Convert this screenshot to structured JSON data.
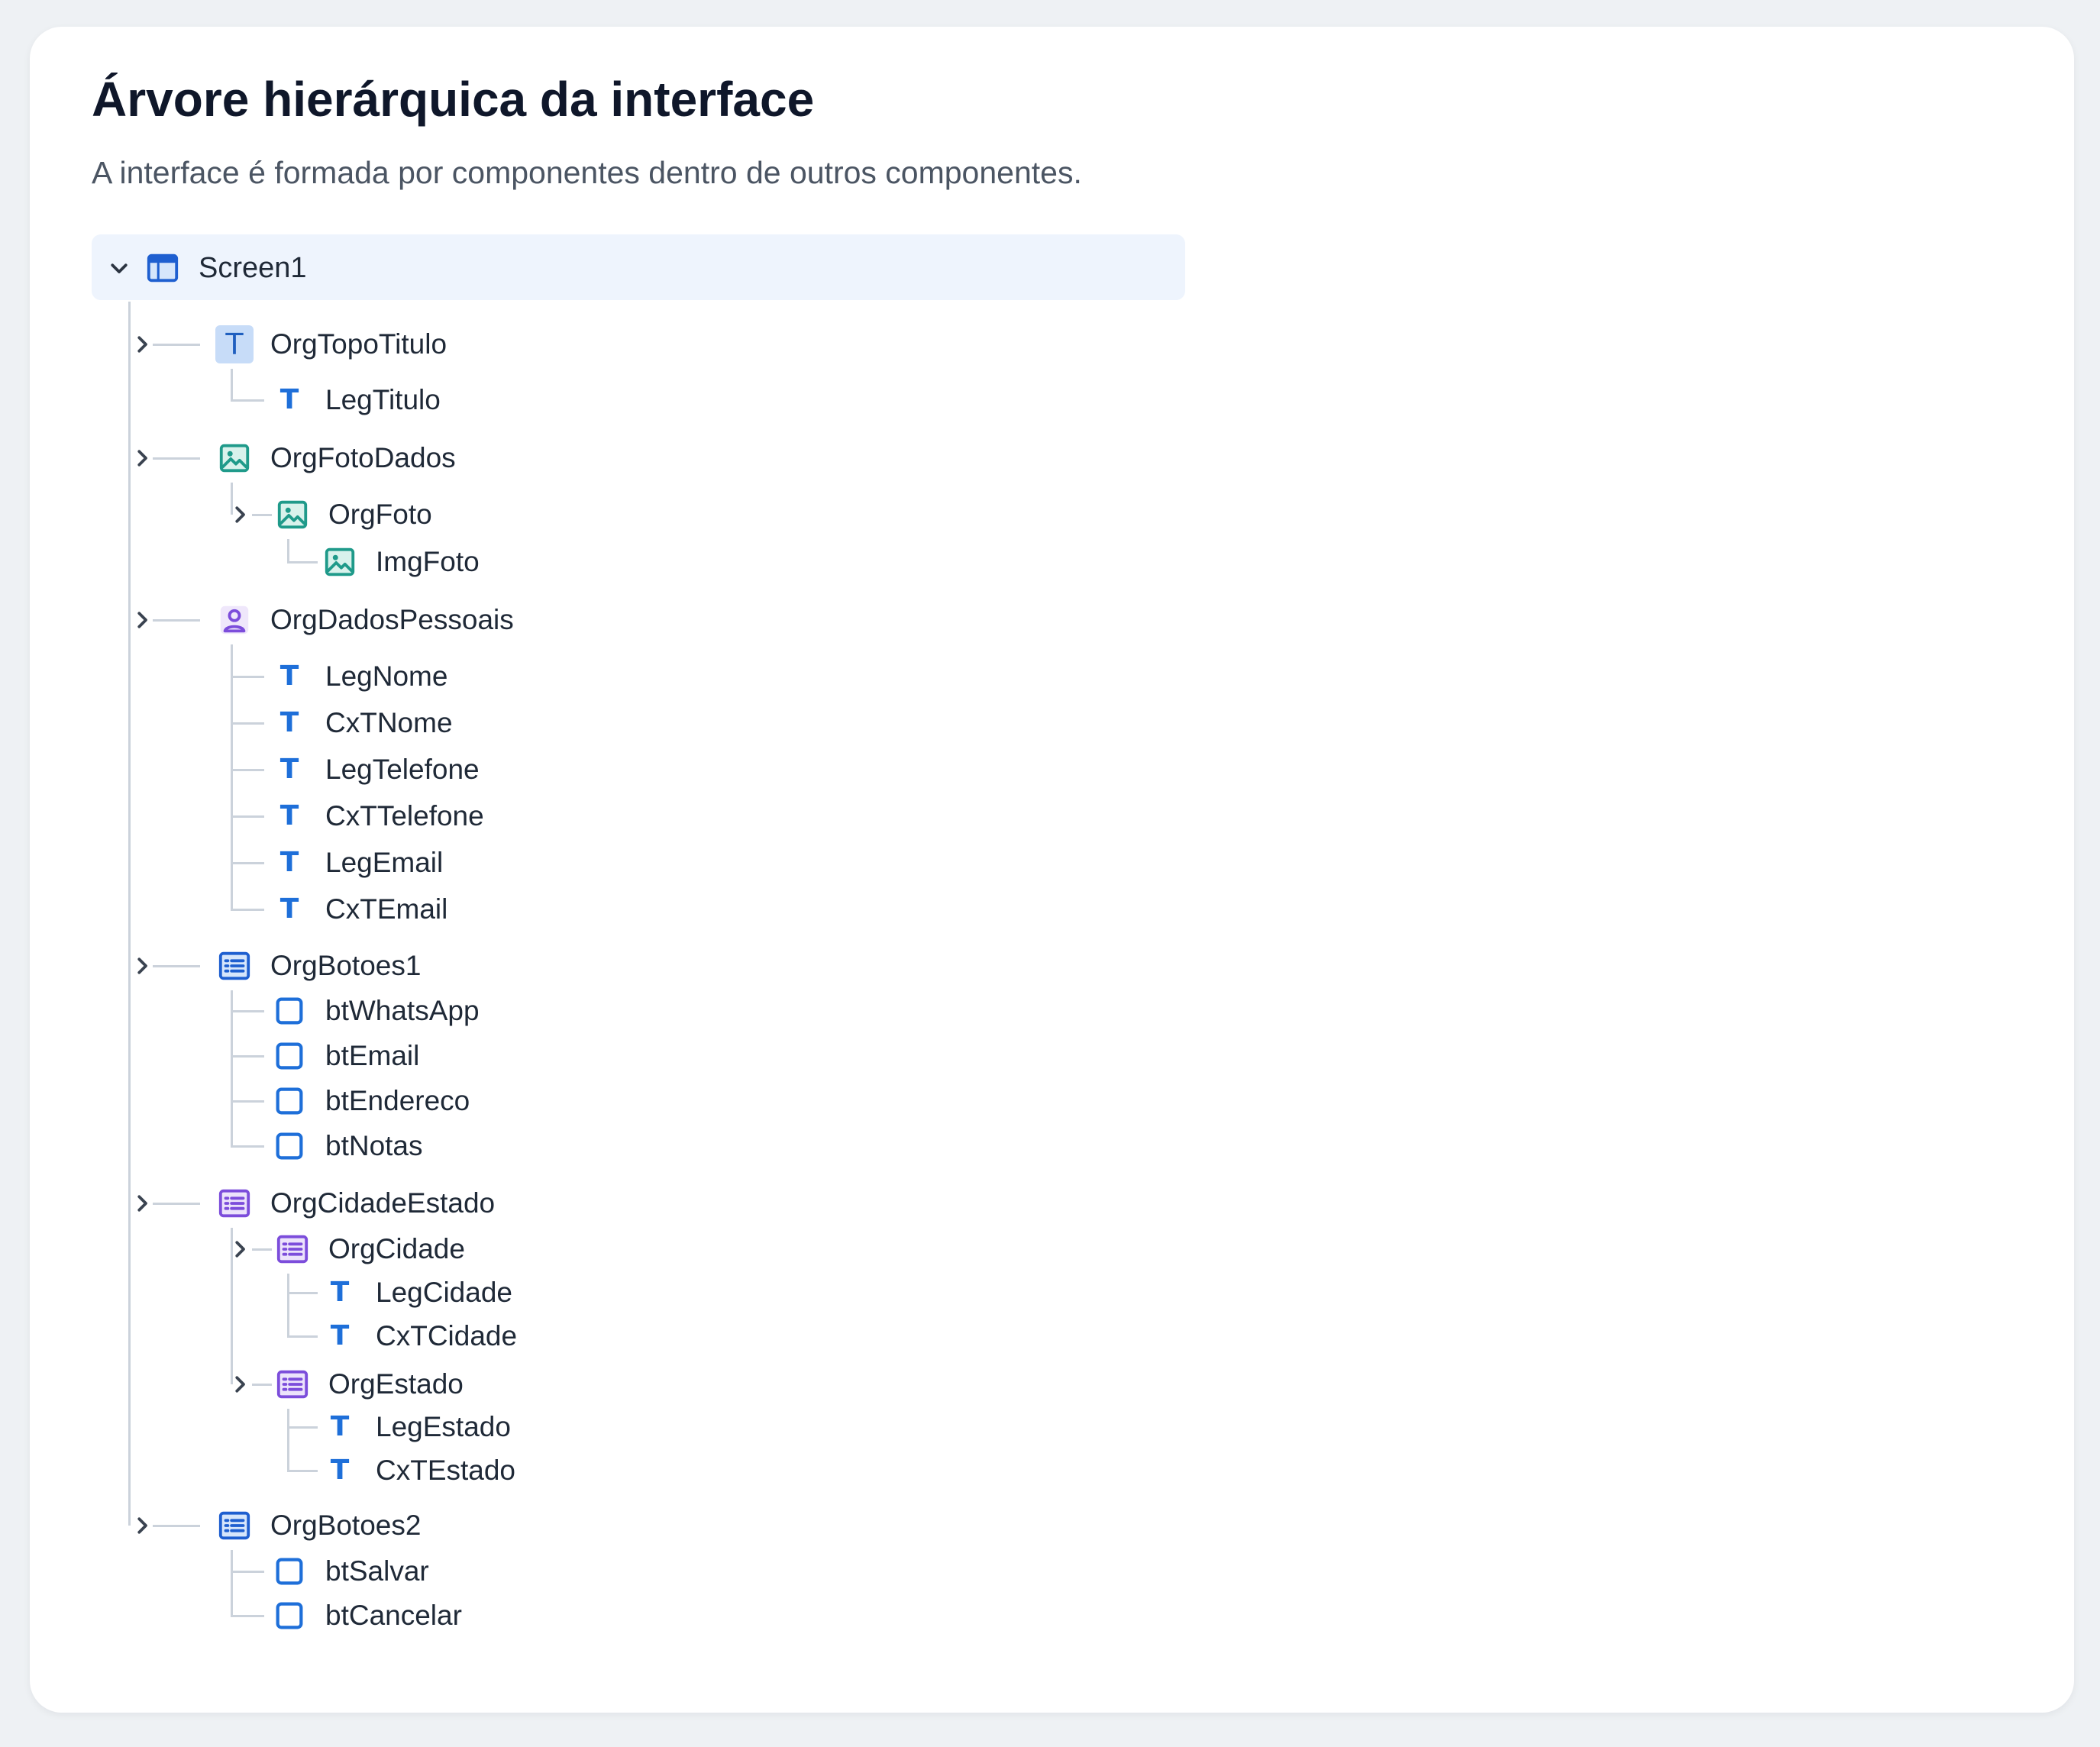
{
  "header": {
    "title": "Árvore hierárquica da interface",
    "subtitle": "A interface é formada por componentes dentro de outros componentes."
  },
  "colors": {
    "text_icon": "#1e6fd9",
    "image_icon": "#1f9a8a",
    "person_icon": "#7c4ddb",
    "list_blue_icon": "#1e5fd0",
    "list_purple_icon": "#7c4ddb",
    "button_icon": "#1e6fd9",
    "tree_line": "#cbd2db",
    "root_highlight": "#eef4fd"
  },
  "tree": {
    "label": "Screen1",
    "icon": "window-icon",
    "expanded": true,
    "children": [
      {
        "label": "OrgTopoTitulo",
        "icon": "text-box-icon",
        "children": [
          {
            "label": "LegTitulo",
            "icon": "text-icon"
          }
        ]
      },
      {
        "label": "OrgFotoDados",
        "icon": "image-icon",
        "children": [
          {
            "label": "OrgFoto",
            "icon": "image-icon",
            "children": [
              {
                "label": "ImgFoto",
                "icon": "image-icon"
              }
            ]
          }
        ]
      },
      {
        "label": "OrgDadosPessoais",
        "icon": "person-icon",
        "children": [
          {
            "label": "LegNome",
            "icon": "text-icon"
          },
          {
            "label": "CxTNome",
            "icon": "text-icon"
          },
          {
            "label": "LegTelefone",
            "icon": "text-icon"
          },
          {
            "label": "CxTTelefone",
            "icon": "text-icon"
          },
          {
            "label": "LegEmail",
            "icon": "text-icon"
          },
          {
            "label": "CxTEmail",
            "icon": "text-icon"
          }
        ]
      },
      {
        "label": "OrgBotoes1",
        "icon": "list-icon",
        "children": [
          {
            "label": "btWhatsApp",
            "icon": "button-icon"
          },
          {
            "label": "btEmail",
            "icon": "button-icon"
          },
          {
            "label": "btEndereco",
            "icon": "button-icon"
          },
          {
            "label": "btNotas",
            "icon": "button-icon"
          }
        ]
      },
      {
        "label": "OrgCidadeEstado",
        "icon": "list-purple-icon",
        "children": [
          {
            "label": "OrgCidade",
            "icon": "list-purple-icon",
            "children": [
              {
                "label": "LegCidade",
                "icon": "text-icon"
              },
              {
                "label": "CxTCidade",
                "icon": "text-icon"
              }
            ]
          },
          {
            "label": "OrgEstado",
            "icon": "list-purple-icon",
            "children": [
              {
                "label": "LegEstado",
                "icon": "text-icon"
              },
              {
                "label": "CxTEstado",
                "icon": "text-icon"
              }
            ]
          }
        ]
      },
      {
        "label": "OrgBotoes2",
        "icon": "list-icon",
        "children": [
          {
            "label": "btSalvar",
            "icon": "button-icon"
          },
          {
            "label": "btCancelar",
            "icon": "button-icon"
          }
        ]
      }
    ]
  }
}
